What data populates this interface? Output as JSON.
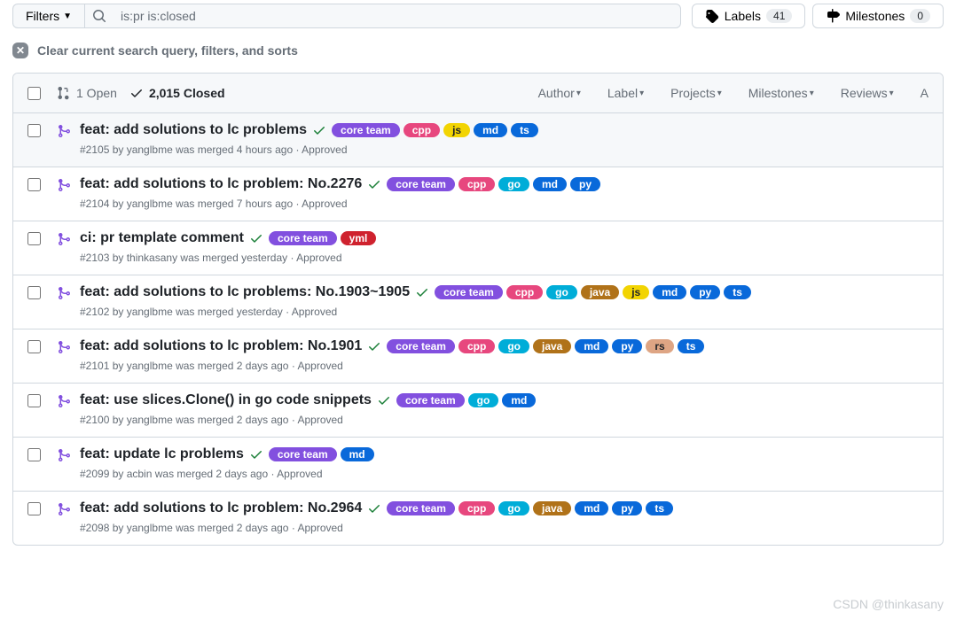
{
  "filters_label": "Filters",
  "search_value": "is:pr is:closed",
  "labels_btn": {
    "text": "Labels",
    "count": "41"
  },
  "milestones_btn": {
    "text": "Milestones",
    "count": "0"
  },
  "clear_text": "Clear current search query, filters, and sorts",
  "header": {
    "open": "1 Open",
    "closed": "2,015 Closed",
    "filters": [
      "Author",
      "Label",
      "Projects",
      "Milestones",
      "Reviews",
      "A"
    ]
  },
  "label_colors": {
    "core team": "#8250df",
    "cpp": "#e7477e",
    "js": "#f2d402",
    "md": "#0969da",
    "ts": "#0969da",
    "go": "#00add8",
    "py": "#0969da",
    "yml": "#cf222e",
    "java": "#b07219",
    "rs": "#dea584"
  },
  "label_text_colors": {
    "js": "#1f2328",
    "rs": "#1f2328"
  },
  "rows": [
    {
      "title": "feat: add solutions to lc problems",
      "labels": [
        "core team",
        "cpp",
        "js",
        "md",
        "ts"
      ],
      "meta": "#2105 by yanglbme was merged 4 hours ago · Approved",
      "hovered": true
    },
    {
      "title": "feat: add solutions to lc problem: No.2276",
      "labels": [
        "core team",
        "cpp",
        "go",
        "md",
        "py"
      ],
      "meta": "#2104 by yanglbme was merged 7 hours ago · Approved"
    },
    {
      "title": "ci: pr template comment",
      "labels": [
        "core team",
        "yml"
      ],
      "meta": "#2103 by thinkasany was merged yesterday · Approved"
    },
    {
      "title": "feat: add solutions to lc problems: No.1903~1905",
      "labels": [
        "core team",
        "cpp",
        "go",
        "java",
        "js",
        "md",
        "py",
        "ts"
      ],
      "meta": "#2102 by yanglbme was merged yesterday · Approved"
    },
    {
      "title": "feat: add solutions to lc problem: No.1901",
      "labels": [
        "core team",
        "cpp",
        "go",
        "java",
        "md",
        "py",
        "rs",
        "ts"
      ],
      "meta": "#2101 by yanglbme was merged 2 days ago · Approved"
    },
    {
      "title": "feat: use slices.Clone() in go code snippets",
      "labels": [
        "core team",
        "go",
        "md"
      ],
      "meta": "#2100 by yanglbme was merged 2 days ago · Approved"
    },
    {
      "title": "feat: update lc problems",
      "labels": [
        "core team",
        "md"
      ],
      "meta": "#2099 by acbin was merged 2 days ago · Approved"
    },
    {
      "title": "feat: add solutions to lc problem: No.2964",
      "labels": [
        "core team",
        "cpp",
        "go",
        "java",
        "md",
        "py",
        "ts"
      ],
      "meta": "#2098 by yanglbme was merged 2 days ago · Approved"
    }
  ],
  "watermark": "CSDN @thinkasany"
}
